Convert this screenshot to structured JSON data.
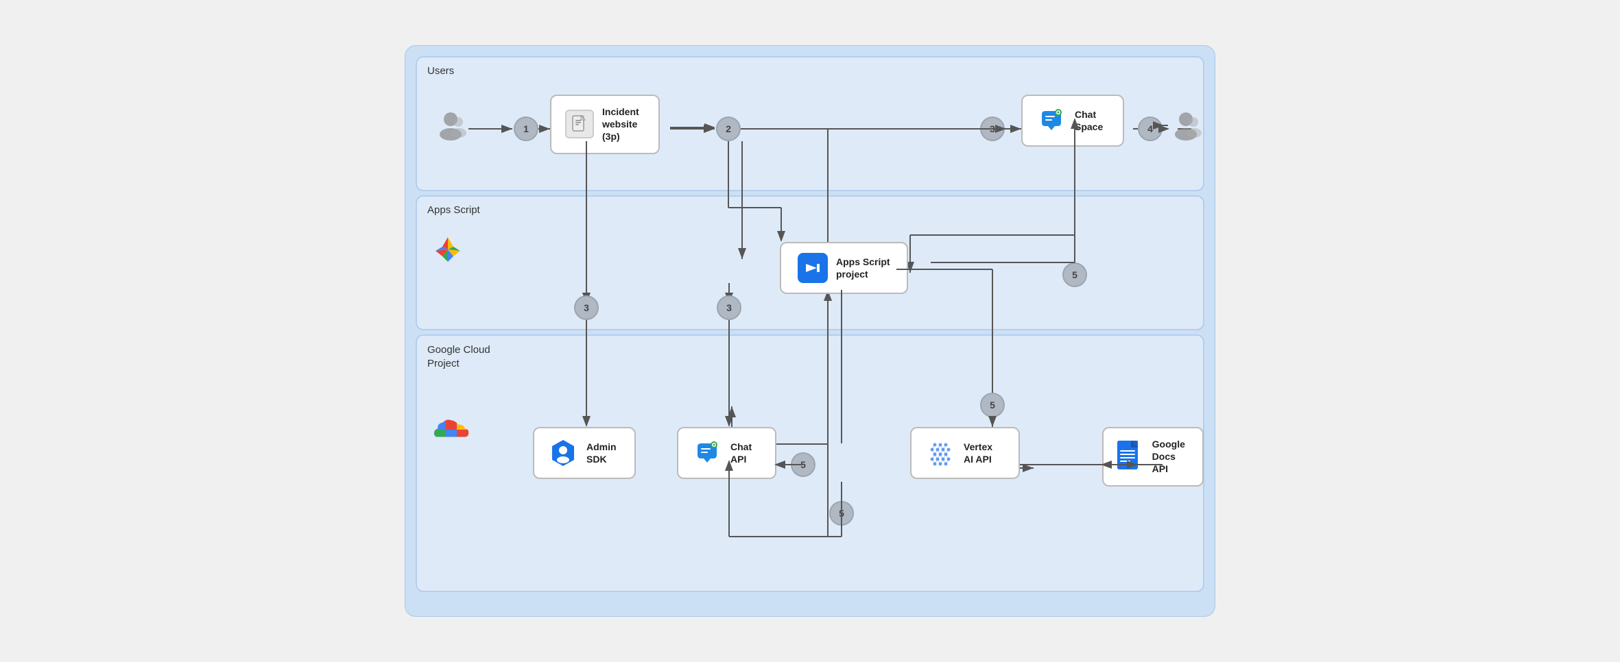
{
  "diagram": {
    "sections": [
      {
        "id": "users",
        "label": "Users"
      },
      {
        "id": "apps-script",
        "label": "Apps Script"
      },
      {
        "id": "google-cloud",
        "label": "Google Cloud\nProject"
      }
    ],
    "boxes": {
      "incident_website": {
        "title": "Incident\nwebsite\n(3p)",
        "icon": "document"
      },
      "apps_script_project": {
        "title": "Apps Script\nproject",
        "icon": "apps-script"
      },
      "chat_space": {
        "title": "Chat\nSpace",
        "icon": "chat"
      },
      "admin_sdk": {
        "title": "Admin\nSDK",
        "icon": "admin-sdk"
      },
      "chat_api": {
        "title": "Chat\nAPI",
        "icon": "chat"
      },
      "vertex_ai": {
        "title": "Vertex\nAI API",
        "icon": "vertex-ai"
      },
      "google_docs": {
        "title": "Google\nDocs API",
        "icon": "docs"
      }
    },
    "nodes": {
      "1": "1",
      "2": "2",
      "3": "3",
      "4": "4",
      "5": "5"
    }
  }
}
